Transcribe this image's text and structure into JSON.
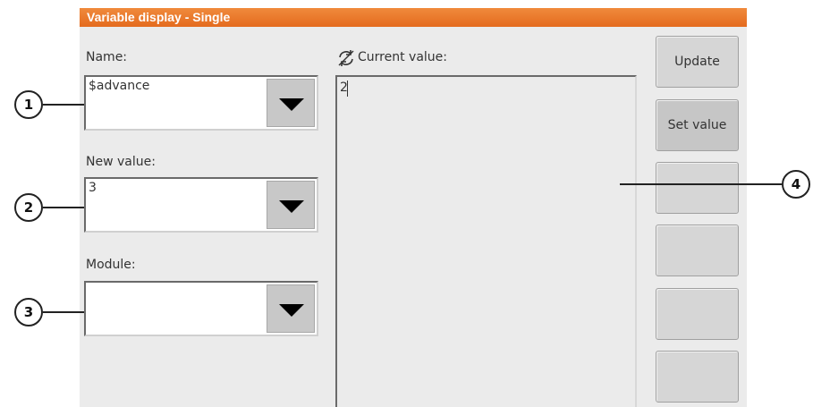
{
  "window": {
    "title": "Variable display - Single"
  },
  "fields": {
    "name_label": "Name:",
    "name_value": "$advance",
    "new_value_label": "New value:",
    "new_value_value": "3",
    "module_label": "Module:",
    "module_value": ""
  },
  "current": {
    "label": "Current value:",
    "value": "2",
    "icon": "refresh-icon"
  },
  "buttons": {
    "update": "Update",
    "set_value": "Set value"
  },
  "callouts": [
    "1",
    "2",
    "3",
    "4"
  ]
}
